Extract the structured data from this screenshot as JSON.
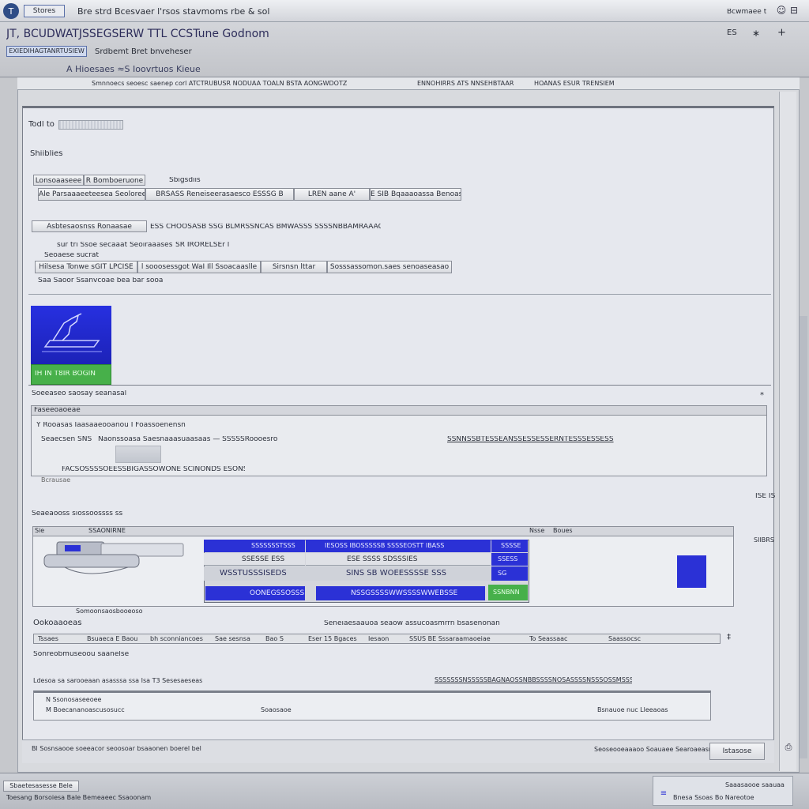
{
  "titlebar": {
    "tab": "Stores",
    "title": "Bre strd Bcesvaer l'rsos stavmoms rbe & sol",
    "right_text": "Bcwmaee t"
  },
  "header": {
    "title": "JT, BCUDWATJSSEGSERW TTL CCSTune Godnom",
    "icons": [
      "ES",
      "∗",
      "+"
    ]
  },
  "subheader": {
    "tab_active": "EXIEDIHAGTANRTUSIEW",
    "tab_label": "Srdbemt Bret bnveheser",
    "path": "A Hioesaes  ≈S  Ioovrtuos  Kieue"
  },
  "toolbar_row": {
    "items": [
      "Smnnoecs seoesc saenep corl  ATCTRUBUSR NODUAA TOALN BSTA AONGWDOTZ",
      "ENNOHIRRS ATS NNSEHBTAAR",
      "HOANAS ESUR TRENSIEM"
    ]
  },
  "form": {
    "field1_label": "Todl  to",
    "field1_value": "",
    "section_label": "Shiiblies",
    "row1": {
      "btn": "Lonsoaaseee",
      "tag": "R Bomboeruone",
      "side": "Sbigsdiis"
    },
    "row2": {
      "a": "Ale Parsaaaeeteesea Seoloree",
      "b": "BRSASS Reneiseerasaesco ESSSG  B",
      "c": "LREN  aane  A'",
      "d": "E  SIB  Bqaaaoassa Benoasnee"
    },
    "row3": {
      "a": "Asbtesaosnss  Ronaasae",
      "b": "ESS  CHOOSASB SSG BLMRSSNCAS BMWASSS SSSSNBBAMRAAAOSSOO  ESAS"
    },
    "row4": {
      "a": "sur  tri Ssoe secaaat  Seoiraaases",
      "b": "SR  IRORELSEr  l"
    },
    "row5": {
      "label": "Seoaese sucrat"
    },
    "row6": {
      "a": "Hilsesa  Tonwe sGIT LPCISE",
      "b": "l  sooosessgot  WaI   Ill Ssoacaaslle",
      "c": "Sirsnsn  lttar",
      "d": "Sosssassomon.saes  senoaseasao"
    },
    "row7": {
      "label": "Saa Saoor  Ssanvcoae  bea  bar sooa"
    }
  },
  "image_block": {
    "caption": "IH IN T8IR BOGIN"
  },
  "group1": {
    "title": "Soeeaseo  saosay  seanasal",
    "box_title": "Faseeoaoeae",
    "line1": "Y  Rooasas  Iaasaaeooanou  I  Foassoenensn",
    "line2a": "Seaecsen  SNS",
    "line2b": "Naonssoasa Saesnaaasuaasaas  —  SSSSSRoooesro",
    "line2c": "SSNNSSBTESSEANSSESSESSERNTESSSESSESS",
    "line3": "FACSOSSSSOEESSBIGASSOWONE  SCINONDS  ESONSOE",
    "footer": "Bcrausae"
  },
  "group2": {
    "title": "Seaeaooss siossoossss  ss",
    "right_text": "ISE  IS",
    "col_a": "Sie",
    "col_b": "SSAONIRNE",
    "col_c": "Nsse",
    "col_d": "Boues",
    "col_e": "SIIBRS",
    "grid": [
      [
        "SSSSSSSTSSS",
        "IESOSS IBOSSSSSB   SSSSEOSTT  IBASS",
        "SSSSE"
      ],
      [
        "SSESSE  ESS",
        "ESE  SSSS SDSSSIES",
        "SSESS"
      ],
      [
        "WSSTUSSSISEDS",
        "SINS  SB  WOEESSSSE  SSS",
        "SG"
      ],
      [
        "OONEGSSOSSS",
        "NSSGSSSSWWSSSSWWEBSSE",
        "SSNBNN"
      ]
    ],
    "below": "Somoonsaosbooeoso"
  },
  "group3": {
    "title": "Ookoaaoeas",
    "subtitle": "Seneiaesaauoa  seaow  assucoasmrrn  bsasenonan",
    "cols": [
      "Tssaes",
      "Bsuaeca   E  Baou",
      "bh sconniancoes",
      "Sae sesnsa",
      "Bao  S",
      "Eser  15  Bgaces",
      "Iesaon",
      "SSUS BE  Sssaraamaoeiae",
      "To   Seassaac",
      "Saassocsc"
    ],
    "field_label": "Sonreobmuseoou saanelse",
    "link_left": "Ldesoa  sa sarooeaan asasssa ssa Isa  T3  Sesesaeseas",
    "link_right": "SSSSSSSNSSSSSBAGNAOSSNBBSSSSNOSASSSSNSSSOSSMSSS",
    "list1": "N  Ssonosaseeoee",
    "list2": "M  Boecananoascusosucc",
    "list2_mid": "Soaosaoe",
    "list2_right": "Bsnauoe  nuc  Lleeaoas"
  },
  "statusbar": {
    "text": "Bl  Sosnsaooe  soeeacor  seoosoar bsaaonen  boerel  bel",
    "right": "Seoseooeaaaoo  Soauaee  Searoaeasnaorne",
    "button": "Istasose"
  },
  "taskbar": {
    "left_top": "Sbaetesasesse Bele",
    "left_bottom": "Toesang  Borsoiesa  Bale  Bemeaeec  Ssaoonam",
    "right_a": "Saaasaooe  saauaa",
    "right_b": "Bnesa  Ssoas  Bo  Nareotoe"
  },
  "colors": {
    "accent_blue": "#2b31d6",
    "accent_green": "#47b04a",
    "window_bg": "#e6e8ee"
  }
}
